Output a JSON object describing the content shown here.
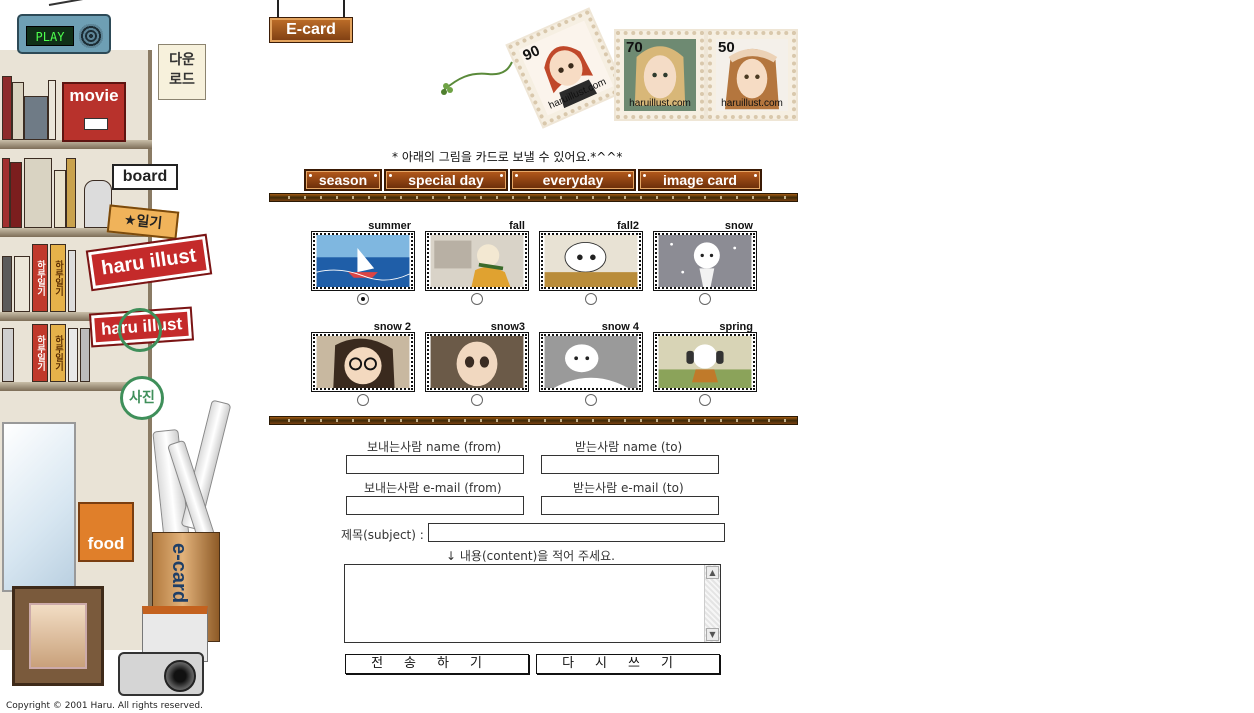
{
  "sidebar": {
    "radio_label": "PLAY",
    "download_label": "다운\n로드",
    "movie_label": "movie",
    "board_label": "board",
    "diary_label": "★일기",
    "haru_label": "haru illust",
    "haru_label2": "haru illust",
    "photo_label": "사진",
    "food_label": "food",
    "ecard_can_label": "e-card",
    "book_spine_label": "하루일기"
  },
  "header": {
    "ecard_sign": "E-card"
  },
  "stamps": [
    {
      "number": "90",
      "site": "haruillust.com",
      "tilt": -24
    },
    {
      "number": "70",
      "site": "haruillust.com",
      "tilt": 0
    },
    {
      "number": "50",
      "site": "haruillust.com",
      "tilt": 0
    }
  ],
  "intro_text": "* 아래의 그림을 카드로 보낼 수 있어요.*^^*",
  "tabs": [
    {
      "label": "season"
    },
    {
      "label": "special day"
    },
    {
      "label": "everyday"
    },
    {
      "label": "image card"
    }
  ],
  "cards": [
    {
      "title": "summer",
      "selected": true
    },
    {
      "title": "fall",
      "selected": false
    },
    {
      "title": "fall2",
      "selected": false
    },
    {
      "title": "snow",
      "selected": false
    },
    {
      "title": "snow 2",
      "selected": false
    },
    {
      "title": "snow3",
      "selected": false
    },
    {
      "title": "snow 4",
      "selected": false
    },
    {
      "title": "spring",
      "selected": false
    }
  ],
  "form": {
    "from_name_label": "보내는사람 name (from)",
    "to_name_label": "받는사람 name (to)",
    "from_email_label": "보내는사람 e-mail (from)",
    "to_email_label": "받는사람 e-mail (to)",
    "subject_label": "제목(subject) :",
    "content_label": "↓ 내용(content)을 적어 주세요.",
    "from_name_value": "",
    "to_name_value": "",
    "from_email_value": "",
    "to_email_value": "",
    "subject_value": "",
    "send_button": "전송하기",
    "reset_button": "다시쓰기",
    "scroll_up": "▲",
    "scroll_down": "▼"
  },
  "footer": {
    "copyright": "Copyright © 2001 Haru. All rights reserved."
  },
  "colors": {
    "tab_brown": "#8a4214",
    "divider_dark": "#3f2a08",
    "sidebar_red": "#c42a2a",
    "sidebar_green": "#3f8f5a"
  }
}
